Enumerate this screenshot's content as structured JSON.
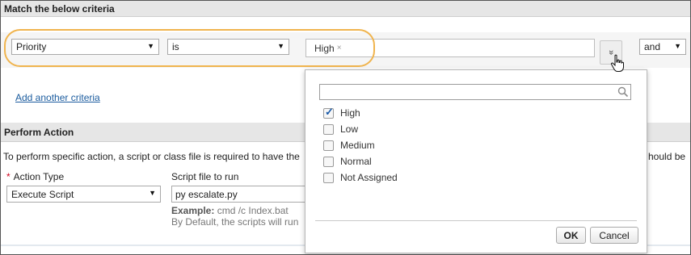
{
  "criteria_section": {
    "title": "Match the below criteria",
    "field_select": "Priority",
    "operator_select": "is",
    "selected_tag": "High",
    "tag_remove": "×",
    "expand_glyph": "»",
    "logic_select": "and",
    "add_link": "Add another criteria"
  },
  "action_section": {
    "title": "Perform Action",
    "info_text": "To perform specific action, a script or class file is required to have the",
    "info_text_right": "hould be",
    "action_type_label": "Action Type",
    "required_mark": "*",
    "action_type_value": "Execute Script",
    "script_label": "Script file to run",
    "script_value": "py escalate.py",
    "example_label": "Example:",
    "example_value": " cmd /c Index.bat",
    "default_note": "By Default, the scripts will run"
  },
  "dropdown": {
    "search_placeholder": "",
    "options": [
      {
        "label": "High",
        "checked": true
      },
      {
        "label": "Low",
        "checked": false
      },
      {
        "label": "Medium",
        "checked": false
      },
      {
        "label": "Normal",
        "checked": false
      },
      {
        "label": "Not Assigned",
        "checked": false
      }
    ],
    "ok_label": "OK",
    "cancel_label": "Cancel"
  },
  "icons": {
    "dropdown_arrow": "▼",
    "check": "✓"
  },
  "colors": {
    "highlight": "#f0b44e",
    "link": "#1a5b9e",
    "required": "#d0021b",
    "header_bg": "#e6e6e6"
  }
}
